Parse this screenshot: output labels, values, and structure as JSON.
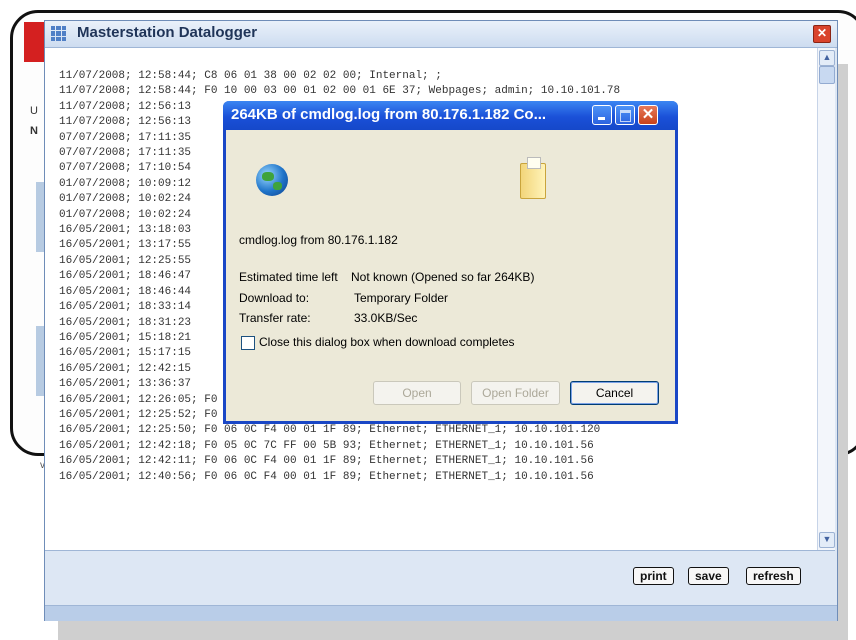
{
  "main_window": {
    "title": "Masterstation Datalogger",
    "log_lines": [
      "11/07/2008; 12:58:44; C8 06 01 38 00 02 02 00; Internal; ;",
      "11/07/2008; 12:58:44; F0 10 00 03 00 01 02 00 01 6E 37; Webpages; admin; 10.10.101.78",
      "11/07/2008; 12:56:13",
      "11/07/2008; 12:56:13                                                    10.10.101.78",
      "07/07/2008; 17:11:35",
      "07/07/2008; 17:11:35                                                    10.10.101.73",
      "07/07/2008; 17:10:54",
      "01/07/2008; 10:09:12",
      "01/07/2008; 10:02:24",
      "01/07/2008; 10:02:24                                                    10.10.101.71",
      "16/05/2001; 13:18:03                                                       0.101.120",
      "16/05/2001; 13:17:55                                                       0.101.120",
      "16/05/2001; 12:25:55                                                       0.101.120",
      "16/05/2001; 18:46:47                                                       0.101.120",
      "16/05/2001; 18:46:44                                                       0.101.120",
      "16/05/2001; 18:33:14                                                       0.101.120",
      "16/05/2001; 18:31:23                                                       0.101.120",
      "16/05/2001; 15:18:21                                                       0.101.120",
      "16/05/2001; 15:17:15                                                       0.101.120",
      "16/05/2001; 12:42:15                                                       0.101.120",
      "16/05/2001; 13:36:37                                                       0.101.120",
      "16/05/2001; 12:26:05; F0 06 0C F4 00 01 1F 89; Ethernet; ETHERNET_1; 10.10.101.120",
      "16/05/2001; 12:25:52; F0 05 0C 7C FF 00 5B 93; Ethernet; ETHERNET_1; 10.10.101.120",
      "16/05/2001; 12:25:50; F0 06 0C F4 00 01 1F 89; Ethernet; ETHERNET_1; 10.10.101.120",
      "16/05/2001; 12:42:18; F0 05 0C 7C FF 00 5B 93; Ethernet; ETHERNET_1; 10.10.101.56",
      "16/05/2001; 12:42:11; F0 06 0C F4 00 01 1F 89; Ethernet; ETHERNET_1; 10.10.101.56",
      "16/05/2001; 12:40:56; F0 06 0C F4 00 01 1F 89; Ethernet; ETHERNET_1; 10.10.101.56"
    ],
    "buttons": {
      "print": "print",
      "save": "save",
      "refresh": "refresh"
    }
  },
  "background": {
    "tab_u": "U",
    "tab_n": "N",
    "letter_v": "v"
  },
  "dialog": {
    "title": "264KB of cmdlog.log from 80.176.1.182 Co...",
    "file_line": "cmdlog.log from 80.176.1.182",
    "est_label": "Estimated time left",
    "est_value": "Not known (Opened so far 264KB)",
    "download_label": "Download to:",
    "download_value": "Temporary Folder",
    "rate_label": "Transfer rate:",
    "rate_value": "33.0KB/Sec",
    "checkbox_label": "Close this dialog box when download completes",
    "buttons": {
      "open": "Open",
      "open_folder": "Open Folder",
      "cancel": "Cancel"
    },
    "close_glyph": "✕"
  },
  "icons": [
    "grid-icon",
    "close-icon",
    "globe-icon",
    "folder-icon",
    "minimize-icon",
    "maximize-icon",
    "scroll-up-icon",
    "scroll-down-icon"
  ]
}
